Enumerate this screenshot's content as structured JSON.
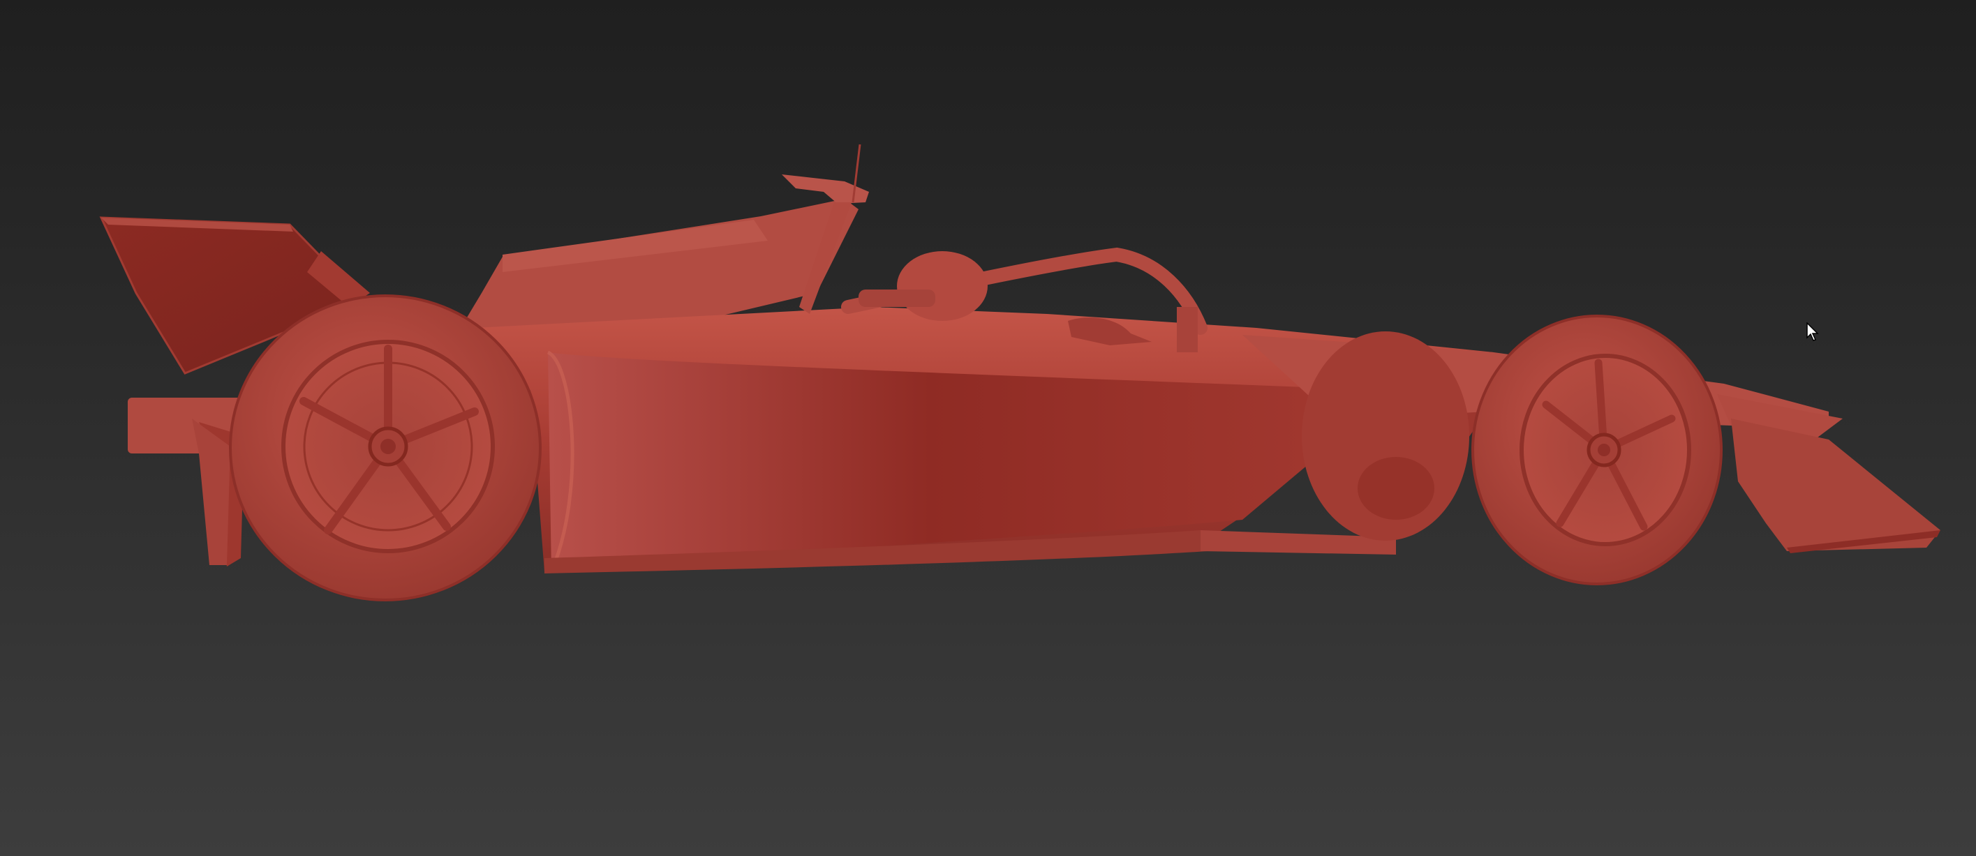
{
  "viewport": {
    "view": "Perspective",
    "shading": "Clay",
    "background_top": "#1f1f1f",
    "background_bottom": "#3d3d3d"
  },
  "model": {
    "object": "formula-car",
    "clay_color": "#b8463c",
    "clay_shadow": "#7a2a24",
    "clay_highlight": "#c95a4e",
    "facing": "right"
  },
  "cursor": {
    "visible": true,
    "icon": "arrow-pointer-icon"
  }
}
